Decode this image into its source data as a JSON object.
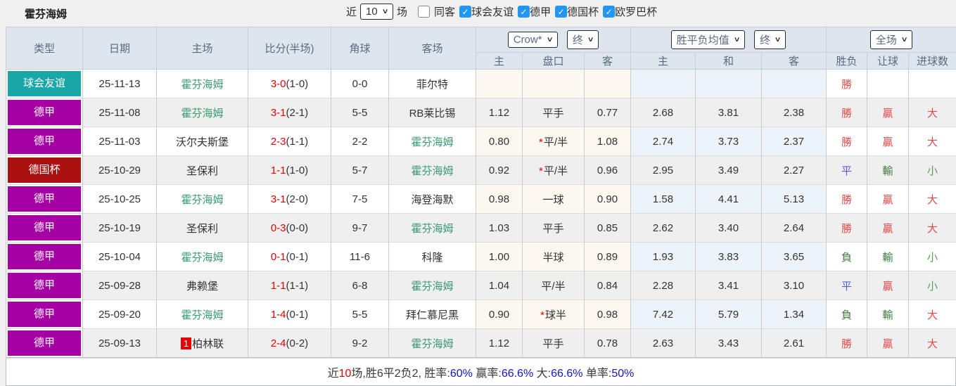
{
  "colors": {
    "checkbox_blue": "#2196F3",
    "score_red": "#E60000",
    "team_green": "#3A9A72",
    "result_red": "#E14B4B",
    "result_blue": "#5A5AE6",
    "result_green": "#3F7B3F",
    "result_green_light": "#55A055",
    "footer_blue": "#1414CC",
    "type_friendly": "#1AA7A7",
    "type_bundesliga": "#A400A4",
    "type_cup": "#AA1111",
    "header_bg": "#DDE5EF"
  },
  "icons": {
    "chevron_down": "∨",
    "check": "✓"
  },
  "topbar": {
    "title": "霍芬海姆",
    "recent_label": "近",
    "recent_select": "10",
    "matches_label": "场",
    "same_venue": {
      "label": "同客",
      "checked": false
    },
    "filters": [
      {
        "label": "球会友谊",
        "checked": true
      },
      {
        "label": "德甲",
        "checked": true
      },
      {
        "label": "德国杯",
        "checked": true
      },
      {
        "label": "欧罗巴杯",
        "checked": true
      }
    ]
  },
  "table": {
    "main_headers": [
      "类型",
      "日期",
      "主场",
      "比分(半场)",
      "角球",
      "客场"
    ],
    "selects": {
      "bookmaker": "Crow*",
      "bookmaker_state": "终",
      "odds_avg": "胜平负均值",
      "odds_state": "终",
      "scope": "全场"
    },
    "sub_headers": [
      "主",
      "盘口",
      "客",
      "主",
      "和",
      "客",
      "胜负",
      "让球",
      "进球数"
    ]
  },
  "rows": [
    {
      "type": {
        "label": "球会友谊",
        "bg": "#1AA7A7"
      },
      "date": "25-11-13",
      "home": {
        "name": "霍芬海姆",
        "green": true,
        "badge": ""
      },
      "score": {
        "ft": "3-0",
        "ht": "(1-0)"
      },
      "corner": "0-0",
      "away": {
        "name": "菲尔特",
        "green": false
      },
      "handicap": {
        "home": "",
        "line": "",
        "star": false,
        "away": ""
      },
      "europe": {
        "home": "",
        "draw": "",
        "away": ""
      },
      "result": {
        "outcome": {
          "text": "勝",
          "color": "#E14B4B"
        },
        "handicap": {
          "text": "",
          "color": ""
        },
        "goals": {
          "text": "",
          "color": ""
        }
      }
    },
    {
      "type": {
        "label": "德甲",
        "bg": "#A400A4"
      },
      "date": "25-11-08",
      "home": {
        "name": "霍芬海姆",
        "green": true,
        "badge": ""
      },
      "score": {
        "ft": "3-1",
        "ht": "(2-1)"
      },
      "corner": "5-5",
      "away": {
        "name": "RB莱比锡",
        "green": false
      },
      "handicap": {
        "home": "1.12",
        "line": "平手",
        "star": false,
        "away": "0.77"
      },
      "europe": {
        "home": "2.68",
        "draw": "3.81",
        "away": "2.38"
      },
      "result": {
        "outcome": {
          "text": "勝",
          "color": "#E14B4B"
        },
        "handicap": {
          "text": "贏",
          "color": "#E14B4B"
        },
        "goals": {
          "text": "大",
          "color": "#E14B4B"
        }
      }
    },
    {
      "type": {
        "label": "德甲",
        "bg": "#A400A4"
      },
      "date": "25-11-03",
      "home": {
        "name": "沃尔夫斯堡",
        "green": false,
        "badge": ""
      },
      "score": {
        "ft": "2-3",
        "ht": "(1-1)"
      },
      "corner": "2-2",
      "away": {
        "name": "霍芬海姆",
        "green": true
      },
      "handicap": {
        "home": "0.80",
        "line": "平/半",
        "star": true,
        "away": "1.08"
      },
      "europe": {
        "home": "2.74",
        "draw": "3.73",
        "away": "2.37"
      },
      "result": {
        "outcome": {
          "text": "勝",
          "color": "#E14B4B"
        },
        "handicap": {
          "text": "贏",
          "color": "#E14B4B"
        },
        "goals": {
          "text": "大",
          "color": "#E14B4B"
        }
      }
    },
    {
      "type": {
        "label": "德国杯",
        "bg": "#AA1111"
      },
      "date": "25-10-29",
      "home": {
        "name": "圣保利",
        "green": false,
        "badge": ""
      },
      "score": {
        "ft": "1-1",
        "ht": "(1-0)"
      },
      "corner": "5-7",
      "away": {
        "name": "霍芬海姆",
        "green": true
      },
      "handicap": {
        "home": "0.92",
        "line": "平/半",
        "star": true,
        "away": "0.96"
      },
      "europe": {
        "home": "2.95",
        "draw": "3.49",
        "away": "2.27"
      },
      "result": {
        "outcome": {
          "text": "平",
          "color": "#5A5AE6"
        },
        "handicap": {
          "text": "輸",
          "color": "#3F7B3F"
        },
        "goals": {
          "text": "小",
          "color": "#55A055"
        }
      }
    },
    {
      "type": {
        "label": "德甲",
        "bg": "#A400A4"
      },
      "date": "25-10-25",
      "home": {
        "name": "霍芬海姆",
        "green": true,
        "badge": ""
      },
      "score": {
        "ft": "3-1",
        "ht": "(2-0)"
      },
      "corner": "7-5",
      "away": {
        "name": "海登海默",
        "green": false
      },
      "handicap": {
        "home": "0.98",
        "line": "一球",
        "star": false,
        "away": "0.90"
      },
      "europe": {
        "home": "1.58",
        "draw": "4.41",
        "away": "5.13"
      },
      "result": {
        "outcome": {
          "text": "勝",
          "color": "#E14B4B"
        },
        "handicap": {
          "text": "贏",
          "color": "#E14B4B"
        },
        "goals": {
          "text": "大",
          "color": "#E14B4B"
        }
      }
    },
    {
      "type": {
        "label": "德甲",
        "bg": "#A400A4"
      },
      "date": "25-10-19",
      "home": {
        "name": "圣保利",
        "green": false,
        "badge": ""
      },
      "score": {
        "ft": "0-3",
        "ht": "(0-0)"
      },
      "corner": "9-7",
      "away": {
        "name": "霍芬海姆",
        "green": true
      },
      "handicap": {
        "home": "1.03",
        "line": "平手",
        "star": false,
        "away": "0.85"
      },
      "europe": {
        "home": "2.62",
        "draw": "3.40",
        "away": "2.64"
      },
      "result": {
        "outcome": {
          "text": "勝",
          "color": "#E14B4B"
        },
        "handicap": {
          "text": "贏",
          "color": "#E14B4B"
        },
        "goals": {
          "text": "大",
          "color": "#E14B4B"
        }
      }
    },
    {
      "type": {
        "label": "德甲",
        "bg": "#A400A4"
      },
      "date": "25-10-04",
      "home": {
        "name": "霍芬海姆",
        "green": true,
        "badge": ""
      },
      "score": {
        "ft": "0-1",
        "ht": "(0-1)"
      },
      "corner": "11-6",
      "away": {
        "name": "科隆",
        "green": false
      },
      "handicap": {
        "home": "1.00",
        "line": "半球",
        "star": false,
        "away": "0.89"
      },
      "europe": {
        "home": "1.93",
        "draw": "3.83",
        "away": "3.65"
      },
      "result": {
        "outcome": {
          "text": "負",
          "color": "#3F7B3F"
        },
        "handicap": {
          "text": "輸",
          "color": "#3F7B3F"
        },
        "goals": {
          "text": "小",
          "color": "#55A055"
        }
      }
    },
    {
      "type": {
        "label": "德甲",
        "bg": "#A400A4"
      },
      "date": "25-09-28",
      "home": {
        "name": "弗赖堡",
        "green": false,
        "badge": ""
      },
      "score": {
        "ft": "1-1",
        "ht": "(1-1)"
      },
      "corner": "6-8",
      "away": {
        "name": "霍芬海姆",
        "green": true
      },
      "handicap": {
        "home": "1.04",
        "line": "平/半",
        "star": false,
        "away": "0.84"
      },
      "europe": {
        "home": "2.28",
        "draw": "3.41",
        "away": "3.10"
      },
      "result": {
        "outcome": {
          "text": "平",
          "color": "#5A5AE6"
        },
        "handicap": {
          "text": "贏",
          "color": "#E14B4B"
        },
        "goals": {
          "text": "小",
          "color": "#55A055"
        }
      }
    },
    {
      "type": {
        "label": "德甲",
        "bg": "#A400A4"
      },
      "date": "25-09-20",
      "home": {
        "name": "霍芬海姆",
        "green": true,
        "badge": ""
      },
      "score": {
        "ft": "1-4",
        "ht": "(0-1)"
      },
      "corner": "5-5",
      "away": {
        "name": "拜仁慕尼黑",
        "green": false
      },
      "handicap": {
        "home": "0.90",
        "line": "球半",
        "star": true,
        "away": "0.98"
      },
      "europe": {
        "home": "7.42",
        "draw": "5.79",
        "away": "1.34"
      },
      "result": {
        "outcome": {
          "text": "負",
          "color": "#3F7B3F"
        },
        "handicap": {
          "text": "輸",
          "color": "#3F7B3F"
        },
        "goals": {
          "text": "大",
          "color": "#E14B4B"
        }
      }
    },
    {
      "type": {
        "label": "德甲",
        "bg": "#A400A4"
      },
      "date": "25-09-13",
      "home": {
        "name": "柏林联",
        "green": false,
        "badge": "1"
      },
      "score": {
        "ft": "2-4",
        "ht": "(0-2)"
      },
      "corner": "9-2",
      "away": {
        "name": "霍芬海姆",
        "green": true
      },
      "handicap": {
        "home": "1.12",
        "line": "平手",
        "star": false,
        "away": "0.78"
      },
      "europe": {
        "home": "2.63",
        "draw": "3.43",
        "away": "2.61"
      },
      "result": {
        "outcome": {
          "text": "勝",
          "color": "#E14B4B"
        },
        "handicap": {
          "text": "贏",
          "color": "#E14B4B"
        },
        "goals": {
          "text": "大",
          "color": "#E14B4B"
        }
      }
    }
  ],
  "footer": {
    "segments": [
      {
        "text": "近",
        "color": "#3A3A3A"
      },
      {
        "text": "10",
        "color": "#E60000"
      },
      {
        "text": "场,胜6平2负2, 胜率:",
        "color": "#3A3A3A"
      },
      {
        "text": "60%",
        "color": "#1414CC"
      },
      {
        "text": " 赢率:",
        "color": "#3A3A3A"
      },
      {
        "text": "66.6%",
        "color": "#1414CC"
      },
      {
        "text": " 大:",
        "color": "#3A3A3A"
      },
      {
        "text": "66.6%",
        "color": "#1414CC"
      },
      {
        "text": " 单率:",
        "color": "#3A3A3A"
      },
      {
        "text": "50%",
        "color": "#1414CC"
      }
    ]
  }
}
